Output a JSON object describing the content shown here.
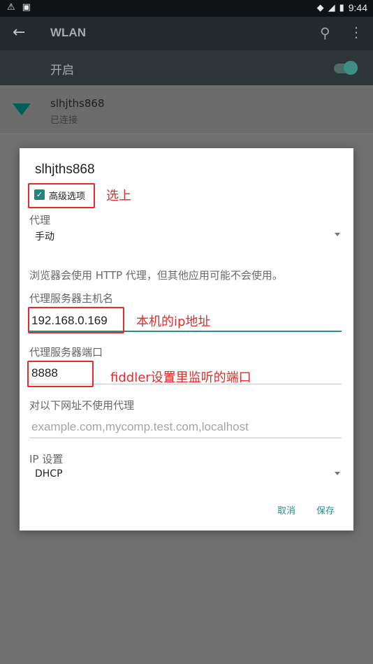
{
  "status_bar": {
    "left_icons": [
      "warning-icon",
      "sim-card-icon"
    ],
    "right_icons": [
      "wifi-signal-icon",
      "cell-signal-icon",
      "battery-icon"
    ],
    "time": "9:44"
  },
  "toolbar": {
    "title": "WLAN",
    "icons": [
      "back-arrow-icon",
      "search-icon",
      "more-vert-icon"
    ]
  },
  "wifi_switch": {
    "label": "开启",
    "state": "on"
  },
  "network": {
    "name": "slhjths868",
    "status": "已连接"
  },
  "dialog": {
    "title": "slhjths868",
    "advanced_checkbox": {
      "label": "高级选项",
      "checked": true
    },
    "proxy": {
      "label": "代理",
      "value": "手动"
    },
    "proxy_note": "浏览器会使用 HTTP 代理，但其他应用可能不会使用。",
    "hostname": {
      "label": "代理服务器主机名",
      "value": "192.168.0.169"
    },
    "port": {
      "label": "代理服务器端口",
      "value": "8888"
    },
    "bypass": {
      "label": "对以下网址不使用代理",
      "placeholder": "example.com,mycomp.test.com,localhost"
    },
    "ip_settings": {
      "label": "IP 设置",
      "value": "DHCP"
    },
    "buttons": {
      "cancel": "取消",
      "save": "保存"
    }
  },
  "annotations": {
    "checkbox_note": "选上",
    "hostname_note": "本机的ip地址",
    "port_note": "fiddler设置里监听的端口",
    "color": "#e52a2a"
  },
  "colors": {
    "accent": "#2a8f86",
    "statusbar": "#0f1315",
    "toolbar": "#23292c"
  }
}
